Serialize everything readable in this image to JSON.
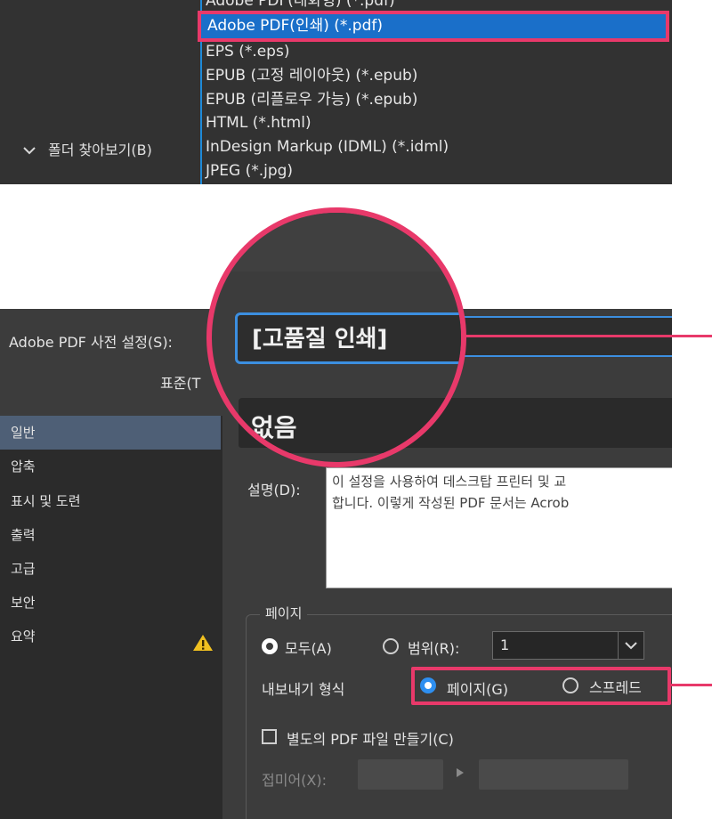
{
  "file_types": {
    "items_above": [
      {
        "label": "Adobe PDF(대화형) (*.pdf)"
      }
    ],
    "selected": "Adobe PDF(인쇄) (*.pdf)",
    "items_below": [
      {
        "label": "EPS (*.eps)"
      },
      {
        "label": "EPUB (고정 레이아웃) (*.epub)"
      },
      {
        "label": "EPUB (리플로우 가능) (*.epub)"
      },
      {
        "label": "HTML (*.html)"
      },
      {
        "label": "InDesign Markup (IDML) (*.idml)"
      },
      {
        "label": "JPEG (*.jpg)"
      }
    ],
    "browse_folders": "폴더 찾아보기(B)"
  },
  "dialog": {
    "preset_label": "Adobe PDF 사전 설정(S):",
    "preset_value": "[고품질 인쇄]",
    "standard_label": "표준(T",
    "standard_value": "없음",
    "sidebar": [
      {
        "label": "일반",
        "active": true
      },
      {
        "label": "압축"
      },
      {
        "label": "표시 및 도련"
      },
      {
        "label": "출력"
      },
      {
        "label": "고급"
      },
      {
        "label": "보안"
      },
      {
        "label": "요약",
        "warning": true
      }
    ],
    "description_label": "설명(D):",
    "description_lines": [
      "이 설정을 사용하여 데스크탑 프린터 및 교",
      "합니다. 이렇게 작성된 PDF 문서는 Acrob"
    ],
    "pages_group": "페이지",
    "all_label": "모두(A)",
    "range_label": "범위(R):",
    "range_value": "1",
    "export_format_label": "내보내기 형식",
    "format_pages": "페이지(G)",
    "format_spreads": "스프레드",
    "separate_pdf": "별도의 PDF 파일 만들기(C)",
    "suffix_label": "접미어(X):"
  },
  "colors": {
    "highlight": "#e8396a",
    "selection_blue": "#1a6fc9",
    "focus_blue": "#3c8fe0",
    "panel_dark": "#323232",
    "dialog_bg": "#3c3c3c"
  },
  "icons": {
    "browse": "chevron-down-icon",
    "warning": "warning-icon",
    "dropdown": "chevron-down-icon"
  }
}
